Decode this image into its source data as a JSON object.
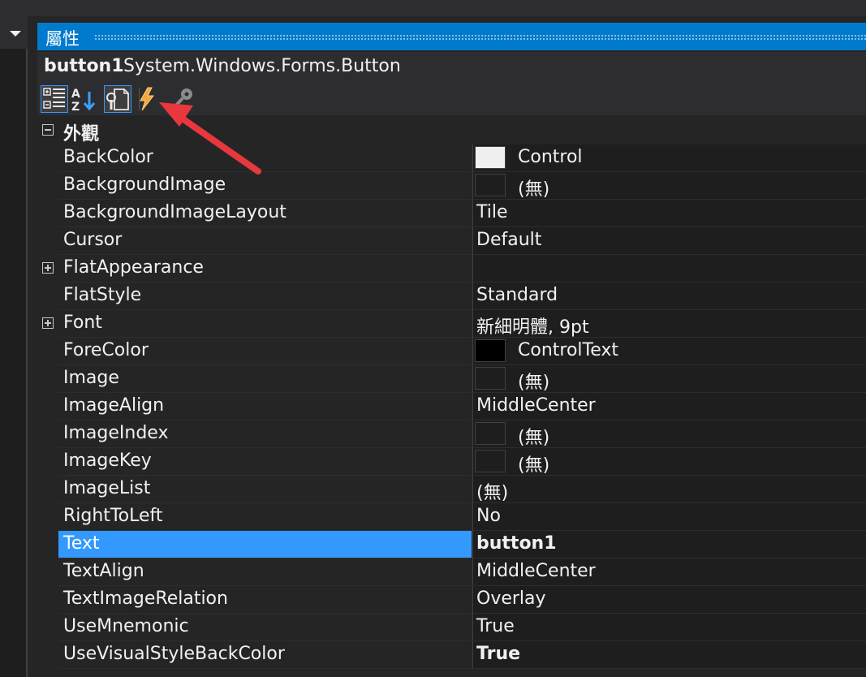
{
  "panel": {
    "title": "屬性"
  },
  "object": {
    "name": "button1",
    "type": "System.Windows.Forms.Button"
  },
  "toolbar": {
    "buttons": [
      {
        "icon": "categorized-icon",
        "selected": true
      },
      {
        "icon": "alphabetical-icon",
        "selected": false
      },
      {
        "icon": "properties-icon",
        "selected": true
      },
      {
        "icon": "events-lightning-icon",
        "selected": false
      },
      {
        "icon": "property-pages-icon",
        "selected": false
      }
    ]
  },
  "category": {
    "label": "外觀",
    "expanded": true
  },
  "properties": [
    {
      "name": "BackColor",
      "value": "Control",
      "swatch": "#f0f0f0"
    },
    {
      "name": "BackgroundImage",
      "value": "(無)",
      "swatch": "#1e1e1e"
    },
    {
      "name": "BackgroundImageLayout",
      "value": "Tile"
    },
    {
      "name": "Cursor",
      "value": "Default"
    },
    {
      "name": "FlatAppearance",
      "value": "",
      "expandable": true
    },
    {
      "name": "FlatStyle",
      "value": "Standard"
    },
    {
      "name": "Font",
      "value": "新細明體, 9pt",
      "expandable": true
    },
    {
      "name": "ForeColor",
      "value": "ControlText",
      "swatch": "#000000"
    },
    {
      "name": "Image",
      "value": "(無)",
      "swatch": "#1e1e1e"
    },
    {
      "name": "ImageAlign",
      "value": "MiddleCenter"
    },
    {
      "name": "ImageIndex",
      "value": "(無)",
      "swatch": "#1e1e1e"
    },
    {
      "name": "ImageKey",
      "value": "(無)",
      "swatch": "#1e1e1e"
    },
    {
      "name": "ImageList",
      "value": "(無)"
    },
    {
      "name": "RightToLeft",
      "value": "No"
    },
    {
      "name": "Text",
      "value": "button1",
      "bold": true,
      "selected": true
    },
    {
      "name": "TextAlign",
      "value": "MiddleCenter"
    },
    {
      "name": "TextImageRelation",
      "value": "Overlay"
    },
    {
      "name": "UseMnemonic",
      "value": "True"
    },
    {
      "name": "UseVisualStyleBackColor",
      "value": "True",
      "bold": true
    }
  ],
  "colors": {
    "accent": "#007acc",
    "selection": "#3399ff",
    "annotation_arrow": "#e8383d"
  }
}
